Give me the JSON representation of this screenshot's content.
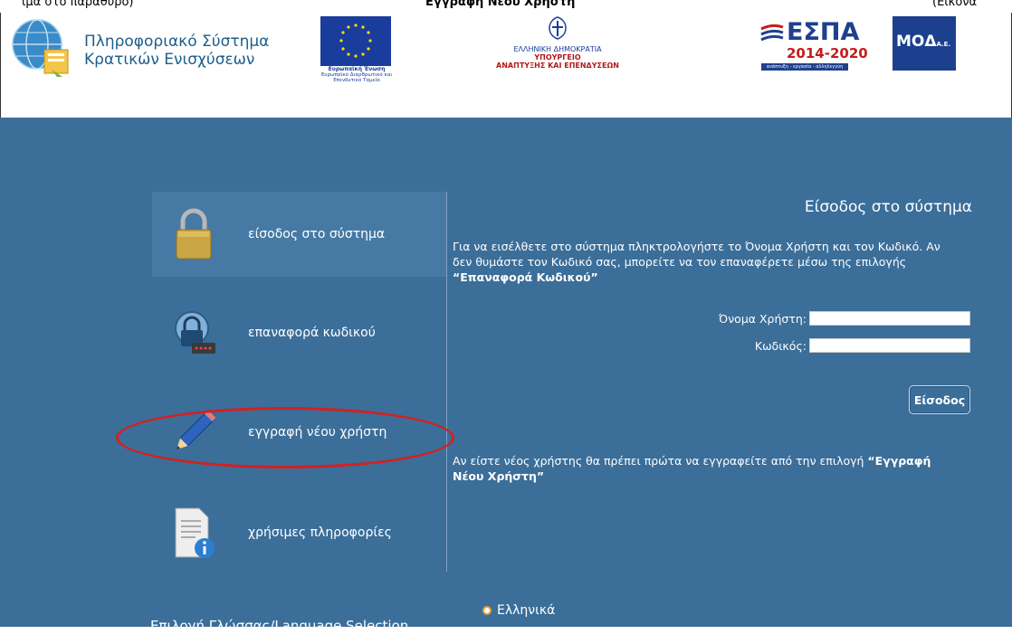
{
  "caption": {
    "left": "ιμα στο παράθυρο)",
    "bold": "Εγγραφή Νέου Χρήστη",
    "right": "(Εικόνα"
  },
  "header": {
    "system_title_line1": "Πληροφοριακό Σύστημα",
    "system_title_line2": "Κρατικών Ενισχύσεων",
    "eu_caption_title": "Ευρωπαϊκή Ένωση",
    "eu_caption_sub": "Ευρωπαϊκό Διαρθρωτικό και Επενδυτικό Ταμείο",
    "gr_line1": "ΕΛΛΗΝΙΚΗ ΔΗΜΟΚΡΑΤΙΑ",
    "gr_line2": "ΥΠΟΥΡΓΕΙΟ",
    "gr_line3": "ΑΝΑΠΤΥΞΗΣ ΚΑΙ ΕΠΕΝΔΥΣΕΩΝ",
    "espa_title": "ΕΣΠΑ",
    "espa_years": "2014-2020",
    "espa_sub": "ανάπτυξη - εργασία - αλληλεγγύη",
    "moa_title": "ΜΟΔ",
    "moa_suffix": "Α.Ε."
  },
  "menu": {
    "items": [
      {
        "label": "είσοδος στο σύστημα",
        "icon": "padlock-icon"
      },
      {
        "label": "επαναφορά κωδικού",
        "icon": "lock-reset-icon"
      },
      {
        "label": "εγγραφή νέου χρήστη",
        "icon": "pencil-icon"
      },
      {
        "label": "χρήσιμες πληροφορίες",
        "icon": "info-document-icon"
      }
    ]
  },
  "login": {
    "title": "Είσοδος στο σύστημα",
    "instructions": "Για να εισέλθετε στο σύστημα πληκτρολογήστε το Όνομα Χρήστη και τον Κωδικό. Αν δεν θυμάστε τον Κωδικό σας, μπορείτε να τον επαναφέρετε μέσω της επιλογής",
    "instructions_bold": "“Επαναφορά Κωδικού”",
    "username_label": "Όνομα Χρήστη:",
    "username_value": "",
    "password_label": "Κωδικός:",
    "password_value": "",
    "submit_label": "Είσοδος",
    "new_user_text": "Αν είστε νέος χρήστης θα πρέπει πρώτα να εγγραφείτε από την επιλογή",
    "new_user_bold": "“Εγγραφή Νέου Χρήστη”"
  },
  "language": {
    "label": "Επιλογή Γλώσσας/Language Selection",
    "selected": "Ελληνικά"
  },
  "colors": {
    "main_bg": "#3b6e99",
    "highlight_oval": "#d42020",
    "title_blue": "#1b5e8c"
  }
}
